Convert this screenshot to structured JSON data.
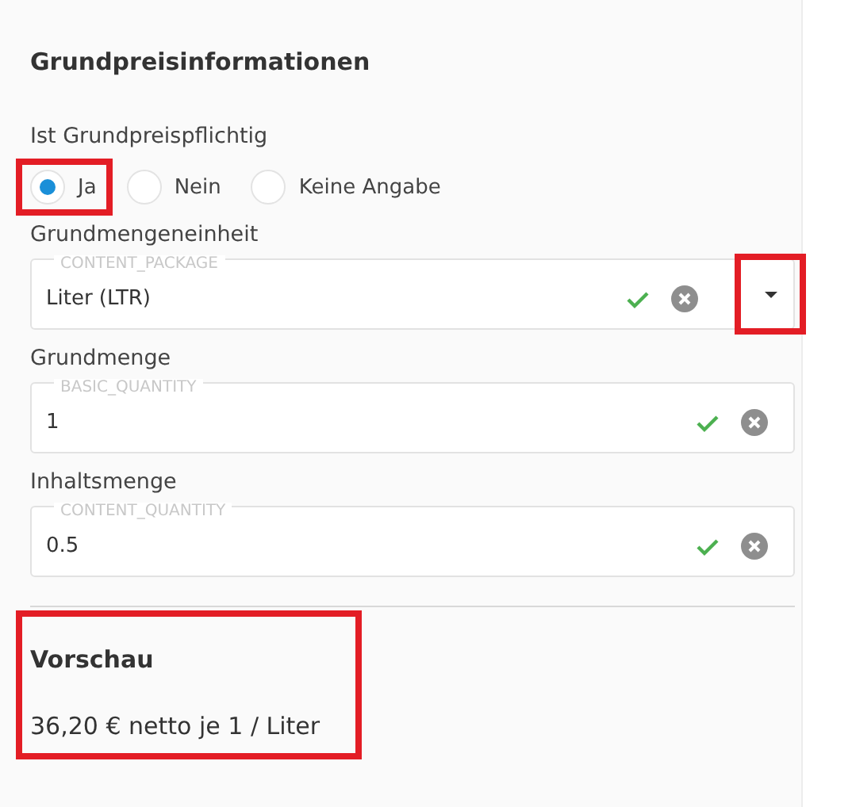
{
  "section_title": "Grundpreisinformationen",
  "radio_group": {
    "label": "Ist Grundpreispflichtig",
    "options": [
      {
        "label": "Ja",
        "selected": true,
        "highlighted": true
      },
      {
        "label": "Nein",
        "selected": false,
        "highlighted": false
      },
      {
        "label": "Keine Angabe",
        "selected": false,
        "highlighted": false
      }
    ]
  },
  "fields": [
    {
      "kind": "select",
      "label": "Grundmengeneinheit",
      "floating_label": "CONTENT_PACKAGE",
      "value": "Liter (LTR)",
      "valid": true,
      "dropdown_highlighted": true
    },
    {
      "kind": "text",
      "label": "Grundmenge",
      "floating_label": "BASIC_QUANTITY",
      "value": "1",
      "valid": true
    },
    {
      "kind": "text",
      "label": "Inhaltsmenge",
      "floating_label": "CONTENT_QUANTITY",
      "value": "0.5",
      "valid": true
    }
  ],
  "preview": {
    "title": "Vorschau",
    "text": "36,20 € netto je 1 / Liter",
    "highlighted": true
  }
}
